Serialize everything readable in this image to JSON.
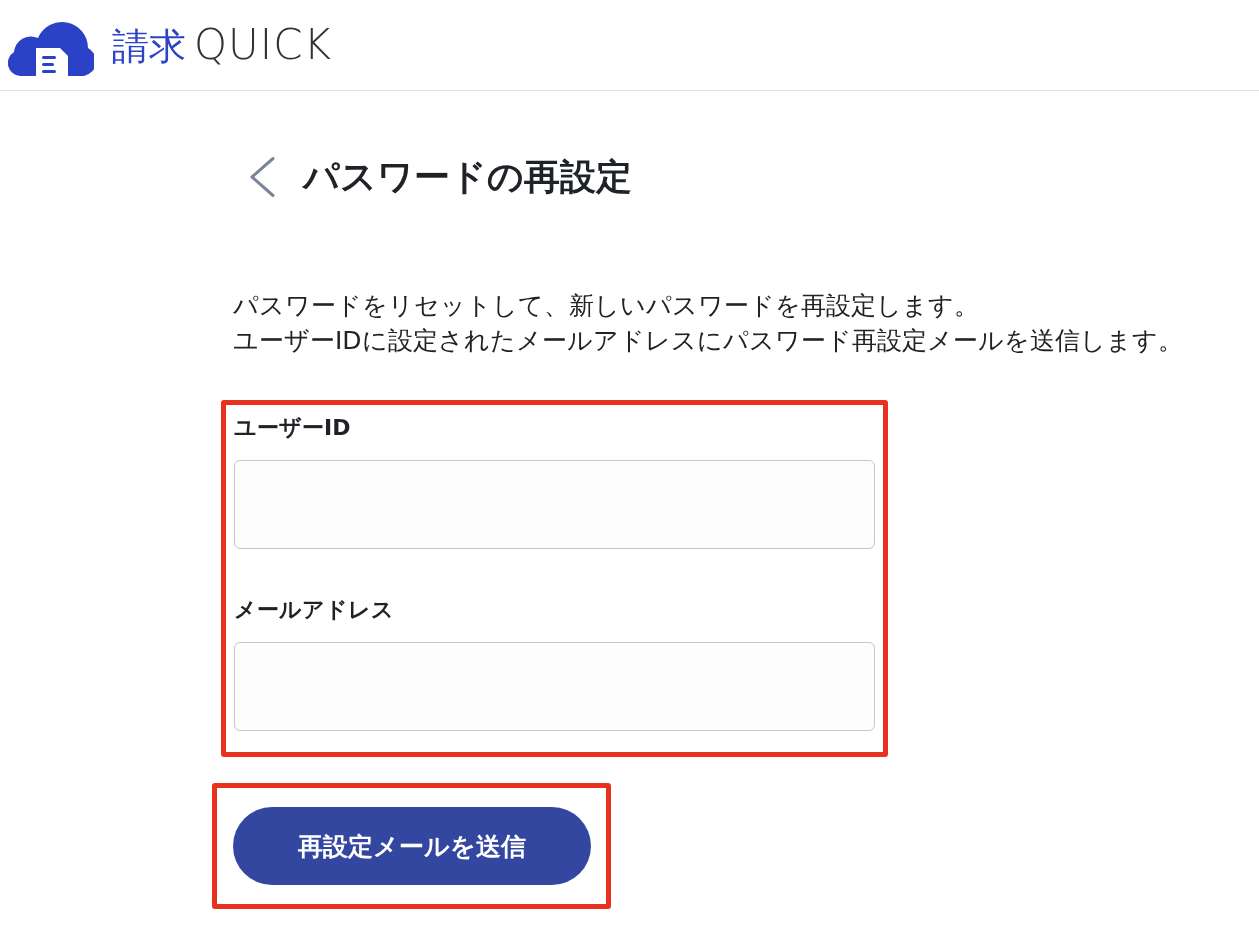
{
  "header": {
    "logo": {
      "text_ja": "請求",
      "text_en": "QUICK"
    }
  },
  "page": {
    "title": "パスワードの再設定"
  },
  "description": [
    "パスワードをリセットして、新しいパスワードを再設定します。",
    "ユーザーIDに設定されたメールアドレスにパスワード再設定メールを送信します。"
  ],
  "form": {
    "highlighted": true,
    "fields": [
      {
        "label": "ユーザーID"
      },
      {
        "label": "メールアドレス"
      }
    ]
  },
  "submit": {
    "label": "再設定メールを送信",
    "highlighted": true
  }
}
